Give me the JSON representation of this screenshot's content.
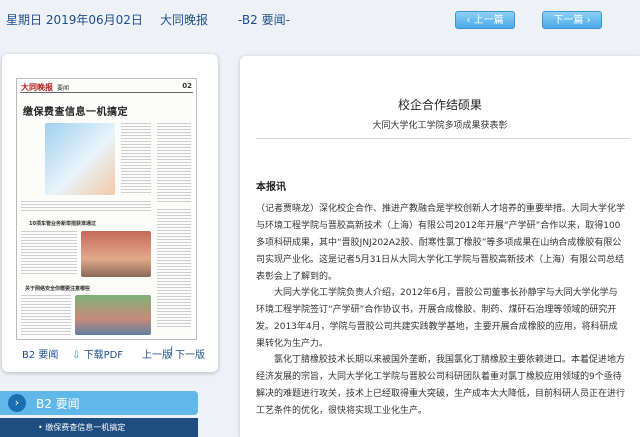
{
  "header": {
    "date": "星期日 2019年06月02日",
    "paper_name": "大同晚报",
    "edition": "-B2 要闻-",
    "prev_button": "上一篇",
    "next_button": "下一篇"
  },
  "thumbnail": {
    "masthead": "大同晚报",
    "section": "要闻",
    "page_no": "02",
    "headline": "缴保费查信息一机搞定",
    "sub1": "10项车管业务新举措获准通过",
    "sub2": "关于网络安全你需要注意哪些"
  },
  "left_footer": {
    "page_label": "B2 要闻",
    "download": "下载PDF",
    "prev_page": "上一版",
    "next_page": "下一版"
  },
  "section_nav": {
    "label": "B2 要闻",
    "items": [
      "缴保费查信息一机搞定"
    ]
  },
  "article": {
    "title": "校企合作结硕果",
    "subtitle": "大同大学化工学院多项成果获表彰",
    "source": "本报讯",
    "paragraphs": [
      "（记者贾晓龙）深化校企合作、推进产教融合是学校创新人才培养的重要举措。大同大学化学与环境工程学院与晋胶高新技术（上海）有限公司2012年开展“产学研”合作以来，取得100多项科研成果，其中“晋胶JNJ202A2胶、耐寒性氯丁橡胶”等多项成果在山纳合成橡胶有限公司实现产业化。这是记者5月31日从大同大学化工学院与晋胶高新技术（上海）有限公司总结表彰会上了解到的。",
      "大同大学化工学院负责人介绍，2012年6月，晋胶公司董事长孙静宇与大同大学化学与环境工程学院签订“产学研”合作协议书，开展合成橡胶、制药、煤矸石治理等领域的研究开发。2013年4月，学院与晋胶公司共建实践教学基地，主要开展合成橡胶的应用，将科研成果转化为生产力。",
      "氯化丁腈橡胶技术长期以来被国外垄断，我国氯化丁腈橡胶主要依赖进口。本着促进地方经济发展的宗旨，大同大学化工学院与晋胶公司科研团队着重对氯丁橡胶应用领域的9个亟待解决的难题进行攻关，技术上已经取得重大突破，生产成本大大降低，目前科研人员正在进行工艺条件的优化，很快将实现工业化生产。"
    ]
  }
}
